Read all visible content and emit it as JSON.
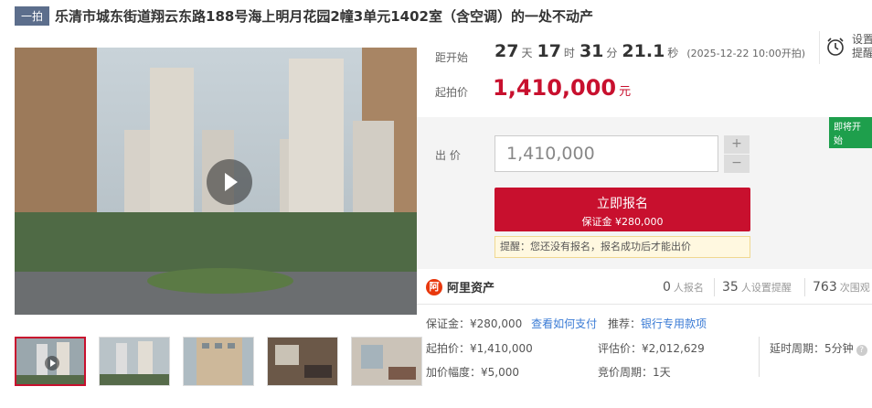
{
  "header": {
    "badge": "一拍",
    "title": "乐清市城东街道翔云东路188号海上明月花园2幢3单元1402室（含空调）的一处不动产"
  },
  "countdown": {
    "label": "距开始",
    "days": "27",
    "days_unit": "天",
    "hours": "17",
    "hours_unit": "时",
    "minutes": "31",
    "minutes_unit": "分",
    "seconds": "21.1",
    "seconds_unit": "秒",
    "start_note": "(2025-12-22 10:00开拍)"
  },
  "reminder": {
    "line1": "设置",
    "line2": "提醒"
  },
  "start_price": {
    "label": "起拍价",
    "value": "1,410,000",
    "unit": "元"
  },
  "bid": {
    "status_tag": "即将开始",
    "label": "出 价",
    "input_value": "1,410,000",
    "plus": "+",
    "minus": "−",
    "apply_label": "立即报名",
    "deposit_line": "保证金 ¥280,000",
    "tip": "提醒：您还没有报名，报名成功后才能出价"
  },
  "brand": {
    "logo_char": "阿",
    "name": "阿里资产"
  },
  "stats": [
    {
      "count": "0",
      "label": "人报名"
    },
    {
      "count": "35",
      "label": "人设置提醒"
    },
    {
      "count": "763",
      "label": "次围观"
    }
  ],
  "info": {
    "deposit_label": "保证金：",
    "deposit_value": "¥280,000",
    "how_to_pay": "查看如何支付",
    "recommend_label": "推荐：",
    "recommend_link": "银行专用款项",
    "start_price_label": "起拍价：",
    "start_price_value": "¥1,410,000",
    "appraisal_label": "评估价：",
    "appraisal_value": "¥2,012,629",
    "delay_label": "延时周期：",
    "delay_value": "5分钟",
    "increment_label": "加价幅度：",
    "increment_value": "¥5,000",
    "bid_cycle_label": "竞价周期：",
    "bid_cycle_value": "1天"
  },
  "colors": {
    "accent": "#c8102e",
    "badge": "#5c6e8c",
    "link": "#3a7bd5",
    "soon": "#1e9f4c"
  }
}
